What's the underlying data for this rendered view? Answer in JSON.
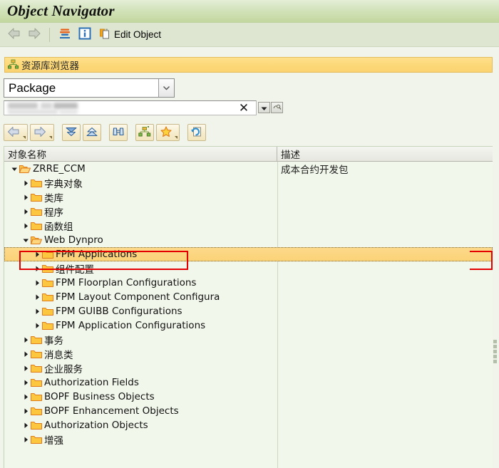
{
  "window": {
    "title": "Object Navigator"
  },
  "app_toolbar": {
    "back_icon": "back-arrow-icon",
    "forward_icon": "forward-arrow-icon",
    "display_icon": "display-object-icon",
    "info_icon": "information-icon",
    "edit_object_icon": "edit-object-icon",
    "edit_object_label": "Edit Object"
  },
  "repository_browser": {
    "header_icon": "hierarchy-icon",
    "header_label": "资源库浏览器",
    "object_type_select": {
      "value": "Package",
      "arrow_icon": "chevron-down-icon"
    },
    "search_field": {
      "value": "",
      "placeholder": "",
      "clear_icon": "close-icon",
      "dropdown_icon": "dropdown-arrow-icon",
      "search_help_icon": "search-help-icon"
    }
  },
  "tree_toolbar": {
    "buttons": [
      {
        "name": "back-button",
        "icon": "back-arrow-icon",
        "caret": true
      },
      {
        "name": "forward-button",
        "icon": "forward-arrow-icon",
        "caret": true
      },
      {
        "name": "expand-all-button",
        "icon": "expand-down-icon",
        "caret": false
      },
      {
        "name": "collapse-all-button",
        "icon": "collapse-up-icon",
        "caret": false
      },
      {
        "name": "find-button",
        "icon": "binoculars-icon",
        "caret": false
      },
      {
        "name": "object-list-button",
        "icon": "hierarchy-icon",
        "caret": false
      },
      {
        "name": "favorites-button",
        "icon": "star-icon",
        "caret": true
      },
      {
        "name": "refresh-button",
        "icon": "refresh-icon",
        "caret": false
      }
    ]
  },
  "tree": {
    "columns": [
      {
        "label": "对象名称"
      },
      {
        "label": "描述"
      }
    ],
    "rows": [
      {
        "label": "ZRRE_CCM",
        "description": "成本合约开发包",
        "depth": 0,
        "state": "expanded",
        "selected": false
      },
      {
        "label": "字典对象",
        "description": "",
        "depth": 1,
        "state": "collapsed",
        "selected": false
      },
      {
        "label": "类库",
        "description": "",
        "depth": 1,
        "state": "collapsed",
        "selected": false
      },
      {
        "label": "程序",
        "description": "",
        "depth": 1,
        "state": "collapsed",
        "selected": false
      },
      {
        "label": "函数组",
        "description": "",
        "depth": 1,
        "state": "collapsed",
        "selected": false
      },
      {
        "label": "Web Dynpro",
        "description": "",
        "depth": 1,
        "state": "expanded",
        "selected": false
      },
      {
        "label": "FPM Applications",
        "description": "",
        "depth": 2,
        "state": "collapsed",
        "selected": true
      },
      {
        "label": "组件配置",
        "description": "",
        "depth": 2,
        "state": "collapsed",
        "selected": false
      },
      {
        "label": "FPM Floorplan Configurations",
        "description": "",
        "depth": 2,
        "state": "collapsed",
        "selected": false
      },
      {
        "label": "FPM Layout Component Configura",
        "description": "",
        "depth": 2,
        "state": "collapsed",
        "selected": false
      },
      {
        "label": "FPM GUIBB Configurations",
        "description": "",
        "depth": 2,
        "state": "collapsed",
        "selected": false
      },
      {
        "label": "FPM Application Configurations",
        "description": "",
        "depth": 2,
        "state": "collapsed",
        "selected": false
      },
      {
        "label": "事务",
        "description": "",
        "depth": 1,
        "state": "collapsed",
        "selected": false
      },
      {
        "label": "消息类",
        "description": "",
        "depth": 1,
        "state": "collapsed",
        "selected": false
      },
      {
        "label": "企业服务",
        "description": "",
        "depth": 1,
        "state": "collapsed",
        "selected": false
      },
      {
        "label": "Authorization Fields",
        "description": "",
        "depth": 1,
        "state": "collapsed",
        "selected": false
      },
      {
        "label": "BOPF Business Objects",
        "description": "",
        "depth": 1,
        "state": "collapsed",
        "selected": false
      },
      {
        "label": "BOPF Enhancement Objects",
        "description": "",
        "depth": 1,
        "state": "collapsed",
        "selected": false
      },
      {
        "label": "Authorization Objects",
        "description": "",
        "depth": 1,
        "state": "collapsed",
        "selected": false
      },
      {
        "label": "增强",
        "description": "",
        "depth": 1,
        "state": "collapsed",
        "selected": false
      }
    ]
  },
  "colors": {
    "title_bar": "#c3d79f",
    "toolbar": "#dee6d1",
    "panel_header": "#fcd877",
    "selection": "#fbd277",
    "tree_background": "#f2f7ec",
    "annotation": "#e40000",
    "folder": "#f6b832"
  }
}
